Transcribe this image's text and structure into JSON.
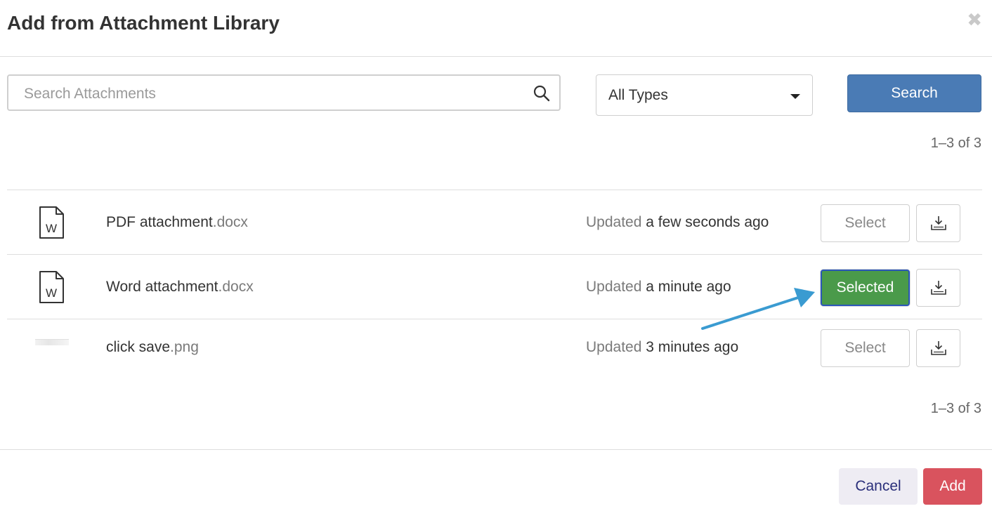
{
  "dialog": {
    "title": "Add from Attachment Library",
    "close_glyph": "✖"
  },
  "search": {
    "placeholder": "Search Attachments",
    "value": "",
    "type_filter": "All Types",
    "button_label": "Search"
  },
  "pagination": {
    "top": "1–3 of 3",
    "bottom": "1–3 of 3"
  },
  "attachments": [
    {
      "icon": "word-file-icon",
      "name": "PDF attachment",
      "ext": ".docx",
      "updated_prefix": "Updated",
      "updated_time": "a few seconds ago",
      "select_label": "Select",
      "selected": false
    },
    {
      "icon": "word-file-icon",
      "name": "Word attachment",
      "ext": ".docx",
      "updated_prefix": "Updated",
      "updated_time": "a minute ago",
      "select_label": "Selected",
      "selected": true
    },
    {
      "icon": "image-thumbnail",
      "name": "click save",
      "ext": ".png",
      "updated_prefix": "Updated",
      "updated_time": "3 minutes ago",
      "select_label": "Select",
      "selected": false
    }
  ],
  "footer": {
    "cancel_label": "Cancel",
    "add_label": "Add"
  },
  "colors": {
    "primary": "#4a7bb5",
    "selected": "#4a9a4a",
    "danger": "#d9535e",
    "annotation_arrow": "#3a9bd1"
  }
}
